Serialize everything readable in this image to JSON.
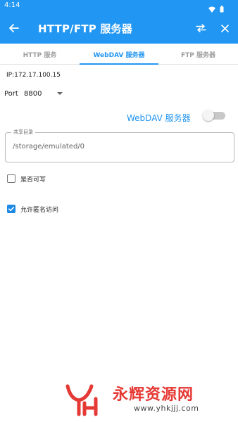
{
  "status": {
    "time": "4:14"
  },
  "toolbar": {
    "title": "HTTP/FTP 服务器"
  },
  "tabs": [
    {
      "label": "HTTP 服务",
      "active": false
    },
    {
      "label": "WebDAV 服务器",
      "active": true
    },
    {
      "label": "FTP 服务器",
      "active": false
    }
  ],
  "server": {
    "ip": "IP:172.17.100.15",
    "port_label": "Port",
    "port_value": "8800",
    "webdav_label": "WebDAV 服务器",
    "webdav_enabled": false
  },
  "shared_dir": {
    "legend": "共享目录",
    "value": "/storage/emulated/0"
  },
  "options": [
    {
      "label": "是否可写",
      "checked": false
    },
    {
      "label": "允许匿名访问",
      "checked": true
    }
  ],
  "watermark": {
    "text": "永辉资源网",
    "url": "www.yhkjjj.com"
  },
  "colors": {
    "primary": "#2196f3",
    "checkbox_checked": "#1e88e5",
    "watermark": "#e53935"
  }
}
